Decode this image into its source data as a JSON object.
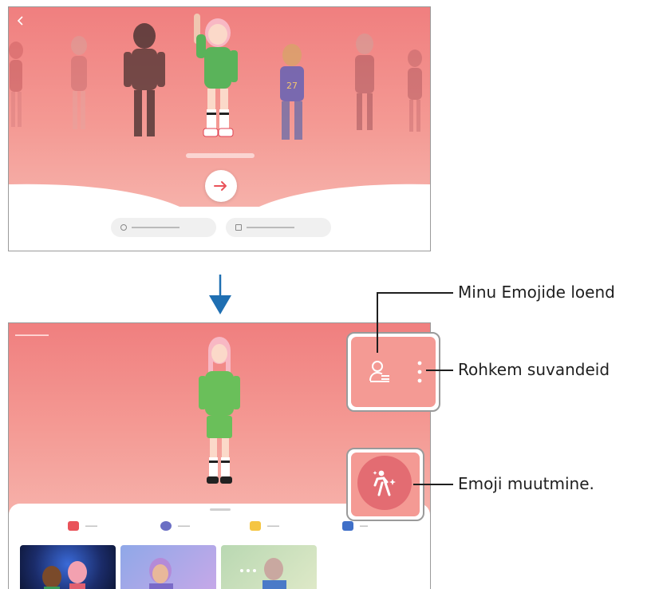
{
  "callouts": {
    "my_emojis_list": "Minu Emojide loend",
    "more_options": "Rohkem suvandeid",
    "edit_emoji": "Emoji muutmine."
  },
  "colors": {
    "background_pink": "#f49a94",
    "accent_red": "#e9535a",
    "arrow_blue": "#1f6fb2",
    "leader_line": "#1f1f1f"
  },
  "icons": {
    "back": "chevron-left-icon",
    "next": "arrow-right-icon",
    "my_emojis": "person-list-icon",
    "more": "more-vertical-icon",
    "edit": "person-sparkle-icon",
    "flow": "arrow-down-icon"
  }
}
